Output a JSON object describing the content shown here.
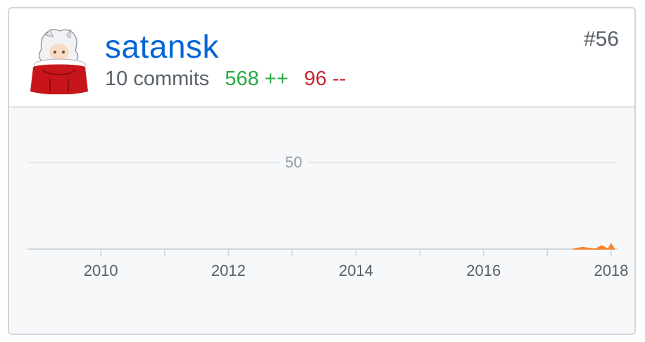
{
  "contributor": {
    "username": "satansk",
    "rank": "#56",
    "commits": "10 commits",
    "additions": "568 ++",
    "deletions": "96 --"
  },
  "colors": {
    "link": "#0366d6",
    "additions": "#28a745",
    "deletions": "#cb2431",
    "chart_area": "#fb8532"
  },
  "chart_data": {
    "type": "area",
    "x_ticks": [
      "2010",
      "2012",
      "2014",
      "2016",
      "2018"
    ],
    "y_ticks": [
      "50"
    ],
    "ylim": [
      0,
      60
    ],
    "xlim": [
      2008.85,
      2018.1
    ],
    "grid": true,
    "series": [
      {
        "x": [
          2017.4,
          2017.55,
          2017.75,
          2017.85,
          2017.95,
          2018.0,
          2018.05
        ],
        "values": [
          0,
          1,
          0,
          2,
          0,
          3,
          0
        ]
      }
    ]
  }
}
